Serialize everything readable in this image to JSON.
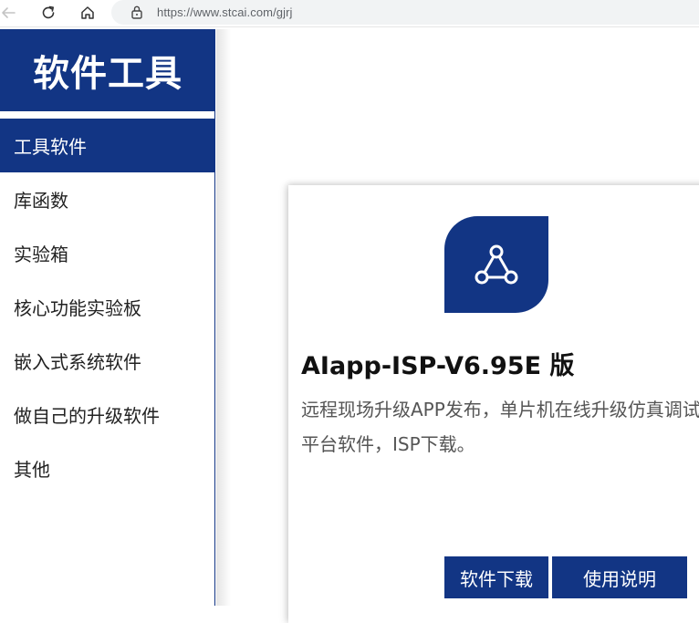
{
  "browser": {
    "url": "https://www.stcai.com/gjrj",
    "icons": [
      "back-arrow-icon",
      "reload-icon",
      "home-icon",
      "lock-icon"
    ]
  },
  "sidebar": {
    "title": "软件工具",
    "items": [
      {
        "label": "工具软件",
        "active": true
      },
      {
        "label": "库函数",
        "active": false
      },
      {
        "label": "实验箱",
        "active": false
      },
      {
        "label": "核心功能实验板",
        "active": false
      },
      {
        "label": "嵌入式系统软件",
        "active": false
      },
      {
        "label": "做自己的升级软件",
        "active": false
      },
      {
        "label": "其他",
        "active": false
      }
    ]
  },
  "card": {
    "icon": "share-network-icon",
    "title": "AIapp-ISP-V6.95E 版",
    "description": "远程现场升级APP发布，单片机在线升级仿真调试平台软件，ISP下载。",
    "download_label": "软件下载",
    "manual_label": "使用说明"
  },
  "colors": {
    "brand": "#123584",
    "text": "#222222",
    "muted": "#555555"
  }
}
